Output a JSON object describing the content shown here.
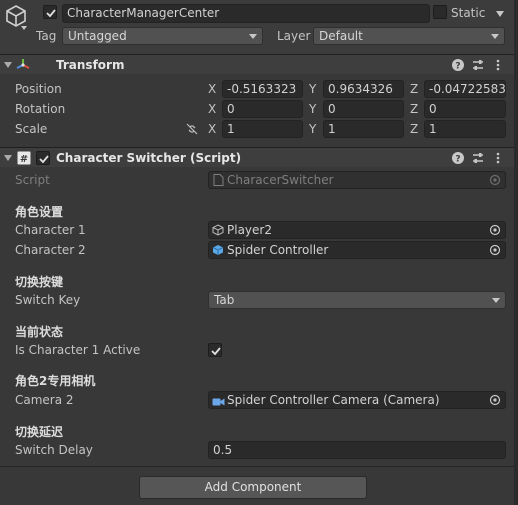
{
  "gameobject": {
    "name": "CharacterManagerCenter",
    "static_label": "Static",
    "tag_label": "Tag",
    "tag_value": "Untagged",
    "layer_label": "Layer",
    "layer_value": "Default",
    "active": true
  },
  "transform": {
    "title": "Transform",
    "position_label": "Position",
    "rotation_label": "Rotation",
    "scale_label": "Scale",
    "axis_x": "X",
    "axis_y": "Y",
    "axis_z": "Z",
    "position": {
      "x": "-0.5163323",
      "y": "0.9634326",
      "z": "-0.04722583"
    },
    "rotation": {
      "x": "0",
      "y": "0",
      "z": "0"
    },
    "scale": {
      "x": "1",
      "y": "1",
      "z": "1"
    }
  },
  "script_component": {
    "title": "Character Switcher (Script)",
    "script_label": "Script",
    "script_value": "CharacerSwitcher",
    "section_role": "角色设置",
    "character1_label": "Character 1",
    "character1_value": "Player2",
    "character2_label": "Character 2",
    "character2_value": "Spider Controller",
    "section_key": "切换按键",
    "switch_key_label": "Switch Key",
    "switch_key_value": "Tab",
    "section_state": "当前状态",
    "is_active_label": "Is Character 1 Active",
    "is_active_value": true,
    "section_camera": "角色2专用相机",
    "camera2_label": "Camera 2",
    "camera2_value": "Spider Controller Camera (Camera)",
    "section_delay": "切换延迟",
    "switch_delay_label": "Switch Delay",
    "switch_delay_value": "0.5"
  },
  "add_component_label": "Add Component",
  "colors": {
    "background": "#383838",
    "field": "#2a2a2a",
    "header": "#3e3e3e",
    "transform_icon_red": "#e04e3a",
    "transform_icon_green": "#6fbf3f",
    "transform_icon_blue": "#4f8fe0",
    "prefab_cube": "#5aa8e6",
    "camera_icon": "#6aa6e8"
  }
}
